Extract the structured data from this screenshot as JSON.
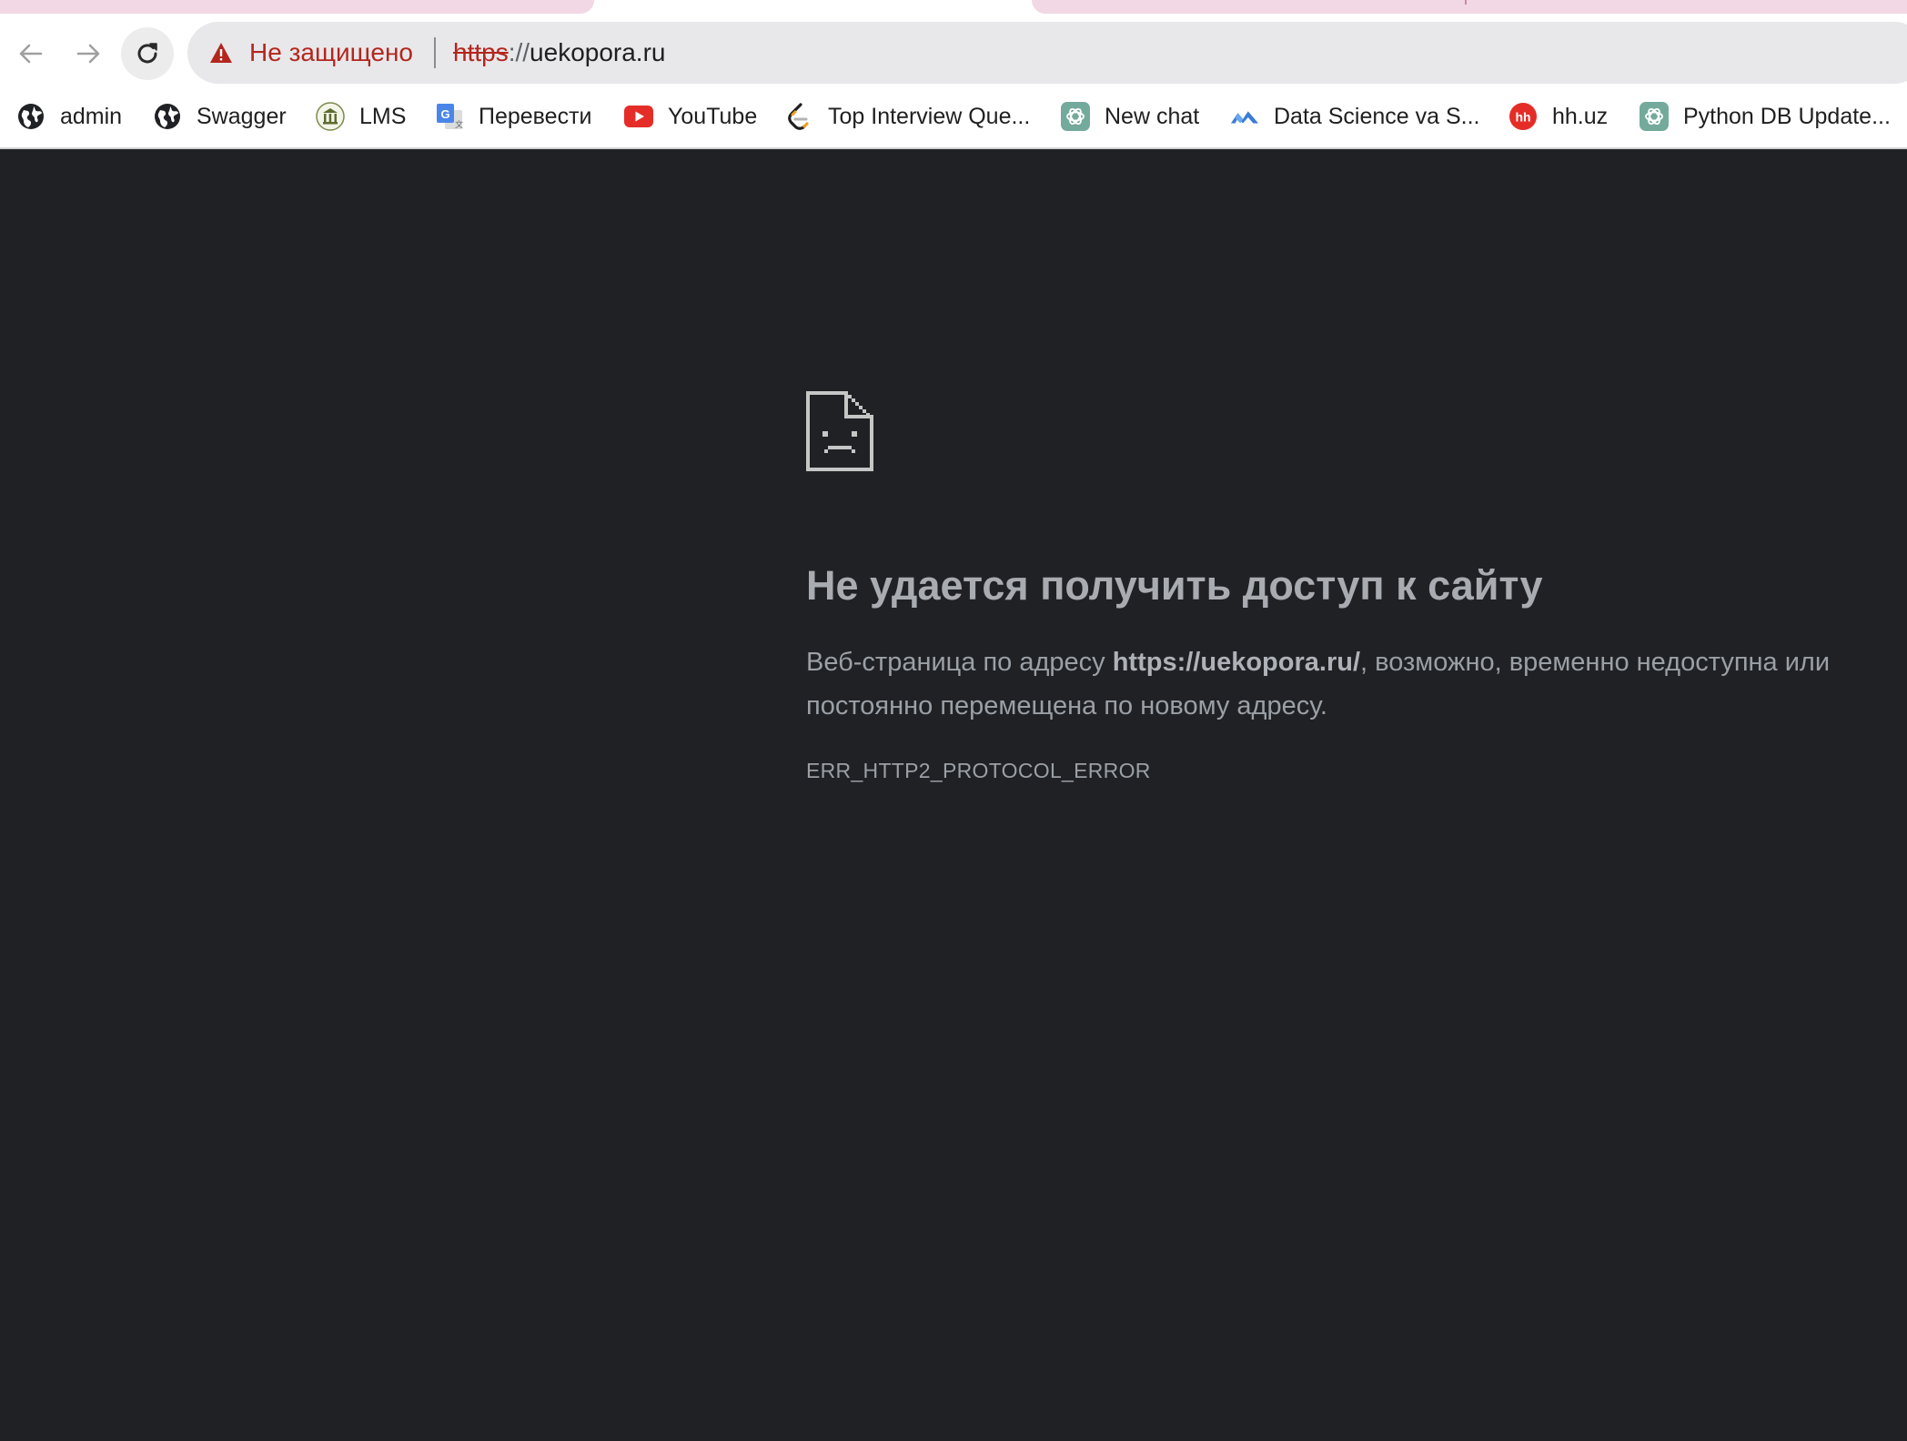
{
  "browser": {
    "security_label": "Не защищено",
    "url_scheme": "https",
    "url_separator": "://",
    "url_host": "uekopora.ru"
  },
  "bookmarks": [
    {
      "label": "admin",
      "icon": "globe-icon"
    },
    {
      "label": "Swagger",
      "icon": "globe-icon"
    },
    {
      "label": "LMS",
      "icon": "university-icon"
    },
    {
      "label": "Перевести",
      "icon": "google-translate-icon"
    },
    {
      "label": "YouTube",
      "icon": "youtube-icon"
    },
    {
      "label": "Top Interview Que...",
      "icon": "leetcode-icon"
    },
    {
      "label": "New chat",
      "icon": "chatgpt-icon"
    },
    {
      "label": "Data Science va S...",
      "icon": "mountains-icon"
    },
    {
      "label": "hh.uz",
      "icon": "hh-icon"
    },
    {
      "label": "Python DB Update...",
      "icon": "chatgpt-icon"
    }
  ],
  "error_page": {
    "title": "Не удается получить доступ к сайту",
    "desc_prefix": "Веб-страница по адресу ",
    "desc_url": "https://uekopora.ru/",
    "desc_suffix": ", возможно, временно недоступна или постоянно перемещена по новому адресу.",
    "code": "ERR_HTTP2_PROTOCOL_ERROR"
  },
  "colors": {
    "page_background": "#202124",
    "insecure_red": "#b3261e",
    "youtube_red": "#e52d27",
    "hh_red": "#e52d27"
  }
}
